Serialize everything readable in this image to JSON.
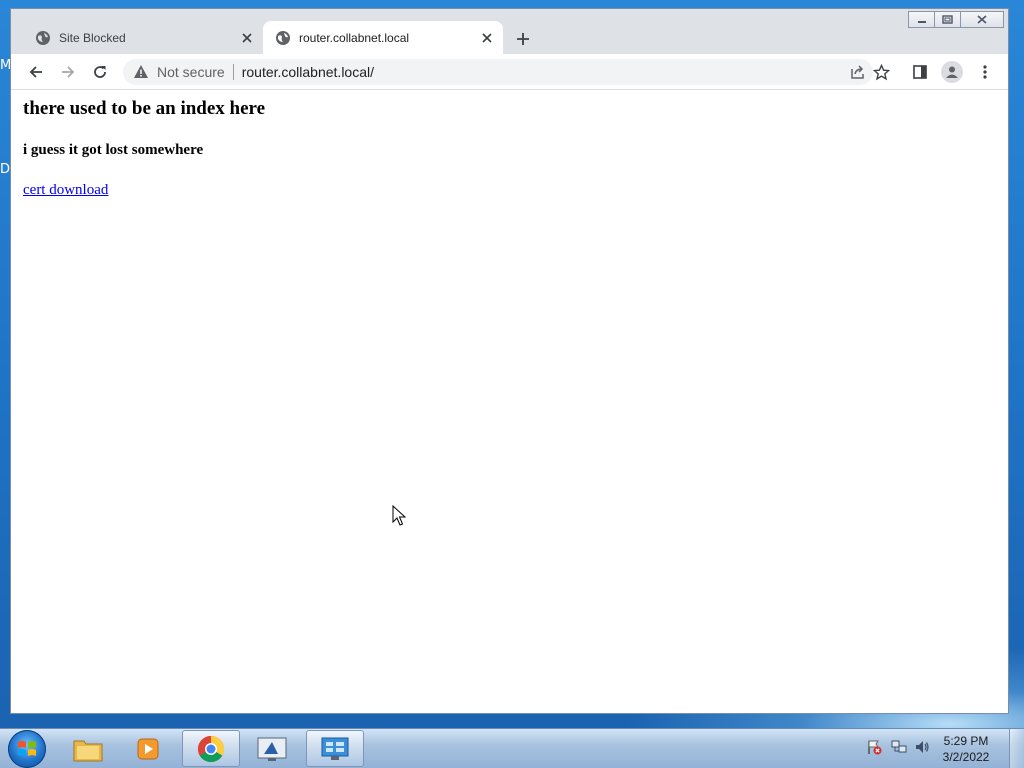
{
  "desktop": {
    "edge_chars": [
      "M",
      "D"
    ]
  },
  "window": {
    "tabs": [
      {
        "label": "Site Blocked",
        "active": false
      },
      {
        "label": "router.collabnet.local",
        "active": true
      }
    ]
  },
  "toolbar": {
    "security_label": "Not secure",
    "url": "router.collabnet.local/"
  },
  "page": {
    "heading": "there used to be an index here",
    "subheading": "i guess it got lost somewhere",
    "link_text": "cert download"
  },
  "taskbar": {
    "clock_time": "5:29 PM",
    "clock_date": "3/2/2022"
  }
}
